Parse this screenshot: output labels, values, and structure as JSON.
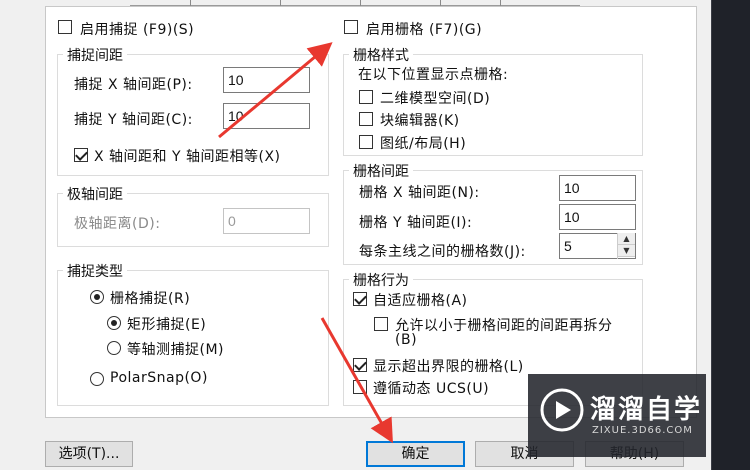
{
  "snap_enable": {
    "label": "启用捕捉 (F9)(S)",
    "checked": false
  },
  "grid_enable": {
    "label": "启用栅格 (F7)(G)",
    "checked": false
  },
  "snap_spacing": {
    "title": "捕捉间距",
    "x_label": "捕捉 X 轴间距(P):",
    "x_value": "10",
    "y_label": "捕捉 Y 轴间距(C):",
    "y_value": "10",
    "equal_label": "X 轴间距和 Y 轴间距相等(X)",
    "equal_checked": true
  },
  "polar_spacing": {
    "title": "极轴间距",
    "distance_label": "极轴距离(D):",
    "distance_value": "0"
  },
  "snap_type": {
    "title": "捕捉类型",
    "grid_snap": "栅格捕捉(R)",
    "rect_snap": "矩形捕捉(E)",
    "iso_snap": "等轴测捕捉(M)",
    "polar_snap": "PolarSnap(O)"
  },
  "grid_style": {
    "title": "栅格样式",
    "caption": "在以下位置显示点栅格:",
    "items": [
      {
        "label": "二维模型空间(D)",
        "checked": false
      },
      {
        "label": "块编辑器(K)",
        "checked": false
      },
      {
        "label": "图纸/布局(H)",
        "checked": false
      }
    ]
  },
  "grid_spacing": {
    "title": "栅格间距",
    "x_label": "栅格 X 轴间距(N):",
    "x_value": "10",
    "y_label": "栅格 Y 轴间距(I):",
    "y_value": "10",
    "major_label": "每条主线之间的栅格数(J):",
    "major_value": "5"
  },
  "grid_behavior": {
    "title": "栅格行为",
    "adaptive": {
      "label": "自适应栅格(A)",
      "checked": true
    },
    "subdivide": {
      "label": "允许以小于栅格间距的间距再拆分",
      "label2": "(B)",
      "checked": false
    },
    "beyond": {
      "label": "显示超出界限的栅格(L)",
      "checked": true
    },
    "follow_ucs": {
      "label": "遵循动态 UCS(U)",
      "checked": false
    }
  },
  "buttons": {
    "options": "选项(T)...",
    "ok": "确定",
    "cancel": "取消",
    "help": "帮助(H)"
  },
  "watermark": {
    "title": "溜溜自学",
    "url": "ZIXUE.3D66.COM"
  },
  "colors": {
    "arrow": "#e8382f",
    "ok_border": "#0078d7"
  }
}
